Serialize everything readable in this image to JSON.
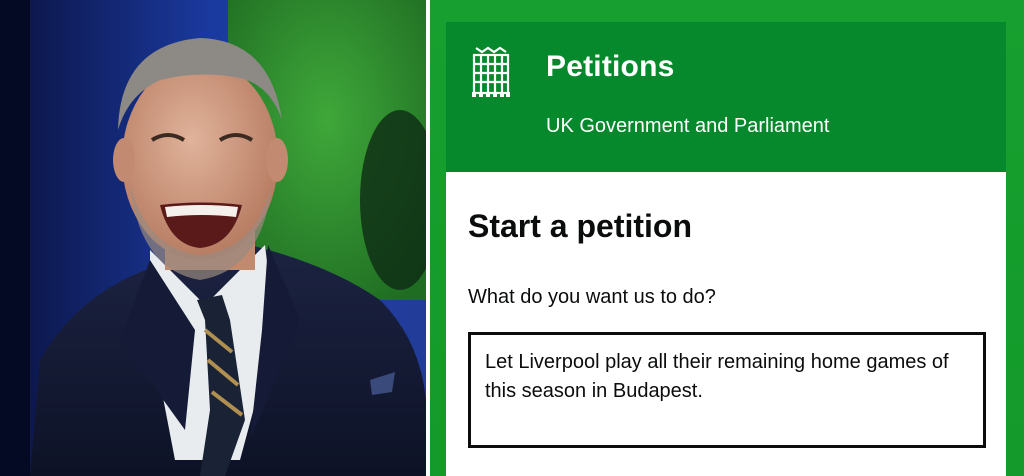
{
  "photo": {
    "alt_subject": "smiling man in suit"
  },
  "petitions": {
    "site_title": "Petitions",
    "site_subtitle": "UK Government and Parliament",
    "logo_icon": "portcullis-icon",
    "page_title": "Start a petition",
    "question_label": "What do you want us to do?",
    "answer_value": "Let Liverpool play all their remaining home games of this season in Budapest."
  },
  "colors": {
    "green_border": "#17a02f",
    "header_green": "#05892c",
    "text": "#0b0c0c"
  }
}
